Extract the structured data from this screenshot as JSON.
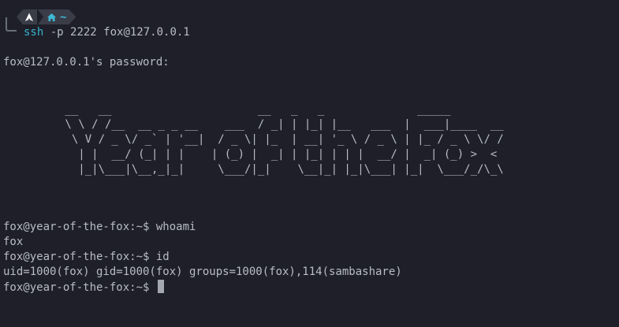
{
  "prompt_header": {
    "os_icon": "arch-linux-icon",
    "home_icon": "home-icon",
    "dir": "~"
  },
  "lines": {
    "ssh_cmd_name": "ssh",
    "ssh_cmd_args": " -p 2222 fox@127.0.0.1",
    "password_prompt": "fox@127.0.0.1's password:",
    "prompt1": "fox@year-of-the-fox:~$ ",
    "cmd1": "whoami",
    "out1": "fox",
    "prompt2": "fox@year-of-the-fox:~$ ",
    "cmd2": "id",
    "out2": "uid=1000(fox) gid=1000(fox) groups=1000(fox),114(sambashare)",
    "prompt3": "fox@year-of-the-fox:~$ "
  },
  "banner": {
    "ascii": " __   __                      __   _   _              _____\n \\ \\ / /__  __ _ _ __    ___  / _| | |_| |__   ___  |  ___|____  __\n  \\ V / _ \\/ _` | '__|  / _ \\| |_  | __| '_ \\ / _ \\ | |_ / _ \\ \\/ /\n   | |  __/ (_| | |    | (_) |  _| | |_| | | |  __/ |  _| (_) >  <\n   |_|\\___|\\__,_|_|     \\___/|_|    \\__|_| |_|\\___| |_|  \\___/_/\\_\\"
  },
  "colors": {
    "background": "#1e1f29",
    "text": "#b8bcc6",
    "accent": "#37b3c9"
  }
}
